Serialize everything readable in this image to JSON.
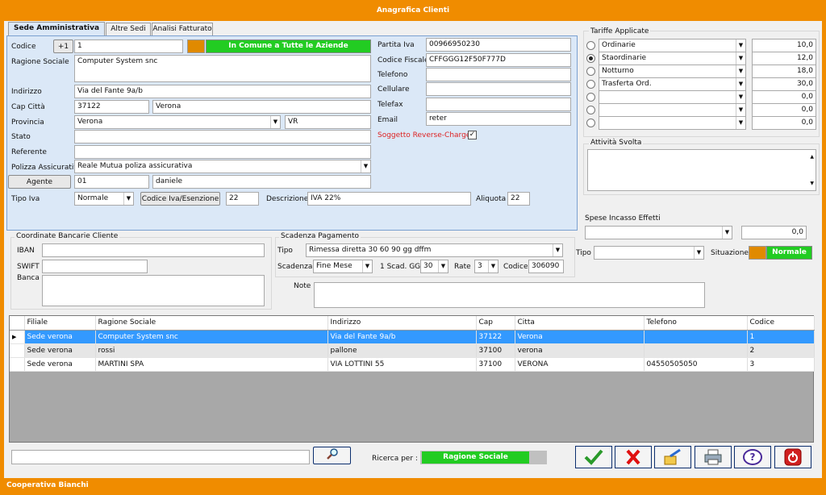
{
  "window": {
    "title": "Anagrafica Clienti",
    "status": "Cooperativa Bianchi"
  },
  "tabs": [
    "Sede Amministrativa",
    "Altre Sedi",
    "Analisi Fatturato"
  ],
  "sede": {
    "codice_label": "Codice",
    "plus_label": "+1",
    "codice": "1",
    "comune_label": "In Comune a Tutte le Aziende",
    "ragione_label": "Ragione Sociale",
    "ragione": "Computer System snc",
    "indirizzo_label": "Indirizzo",
    "indirizzo": "Via del Fante 9a/b",
    "cap_label": "Cap Città",
    "cap": "37122",
    "citta": "Verona",
    "provincia_label": "Provincia",
    "provincia": "Verona",
    "sigla": "VR",
    "stato_label": "Stato",
    "stato": "",
    "referente_label": "Referente",
    "referente": "",
    "polizza_label": "Polizza Assicurativa",
    "polizza": "Reale Mutua poliza assicurativa",
    "agente_label": "Agente",
    "agente_code": "01",
    "agente_name": "daniele",
    "tipoiva_label": "Tipo Iva",
    "tipoiva": "Normale",
    "codiva_label": "Codice Iva/Esenzione",
    "codiva": "22",
    "descr_label": "Descrizione",
    "descr": "IVA 22%",
    "aliquota_label": "Aliquota",
    "aliquota": "22",
    "piva_label": "Partita Iva",
    "piva": "00966950230",
    "cf_label": "Codice Fiscale",
    "cf": "CFFGGG12F50F777D",
    "tel_label": "Telefono",
    "tel": "",
    "cell_label": "Cellulare",
    "cell": "",
    "fax_label": "Telefax",
    "fax": "",
    "email_label": "Email",
    "email": "reter",
    "reverse_label": "Soggetto Reverse-Charge"
  },
  "tariffe": {
    "title": "Tariffe Applicate",
    "rows": [
      {
        "name": "Ordinarie",
        "value": "10,0"
      },
      {
        "name": "Staordinarie",
        "value": "12,0"
      },
      {
        "name": "Notturno",
        "value": "18,0"
      },
      {
        "name": "Trasferta Ord.",
        "value": "30,0"
      },
      {
        "name": "",
        "value": "0,0"
      },
      {
        "name": "",
        "value": "0,0"
      },
      {
        "name": "",
        "value": "0,0"
      }
    ],
    "attivita_label": "Attività Svolta"
  },
  "spese": {
    "title": "Spese Incasso Effetti",
    "value": "0,0",
    "tipo_label": "Tipo",
    "situazione_label": "Situazione",
    "situazione": "Normale"
  },
  "banca": {
    "title": "Coordinate Bancarie Cliente",
    "iban_label": "IBAN",
    "swift_label": "SWIFT",
    "banca_label": "Banca"
  },
  "scadenza": {
    "title": "Scadenza Pagamento",
    "tipo_label": "Tipo",
    "tipo": "Rimessa diretta 30 60 90 gg dffm",
    "scad_label": "Scadenza",
    "scad": "Fine Mese",
    "gg_label": "1 Scad. GG",
    "gg": "30",
    "rate_label": "Rate",
    "rate": "3",
    "codice_label": "Codice",
    "codice": "306090",
    "note_label": "Note"
  },
  "grid": {
    "headers": [
      "Filiale",
      "Ragione Sociale",
      "Indirizzo",
      "Cap",
      "Citta",
      "Telefono",
      "Codice"
    ],
    "rows": [
      [
        "Sede verona",
        "Computer System snc",
        "Via del Fante 9a/b",
        "37122",
        "Verona",
        "",
        "1"
      ],
      [
        "Sede verona",
        "rossi",
        "pallone",
        "37100",
        "verona",
        "",
        "2"
      ],
      [
        "Sede verona",
        "MARTINI SPA",
        "VIA LOTTINI 55",
        "37100",
        "VERONA",
        "04550505050",
        "3"
      ]
    ]
  },
  "search": {
    "ricerca_label": "Ricerca per :",
    "ricerca_value": "Ragione Sociale"
  },
  "colors": {
    "accent": "#f08c00",
    "green": "#22cc22",
    "blue_panel": "#dbe8f7",
    "selection": "#3399ff"
  }
}
